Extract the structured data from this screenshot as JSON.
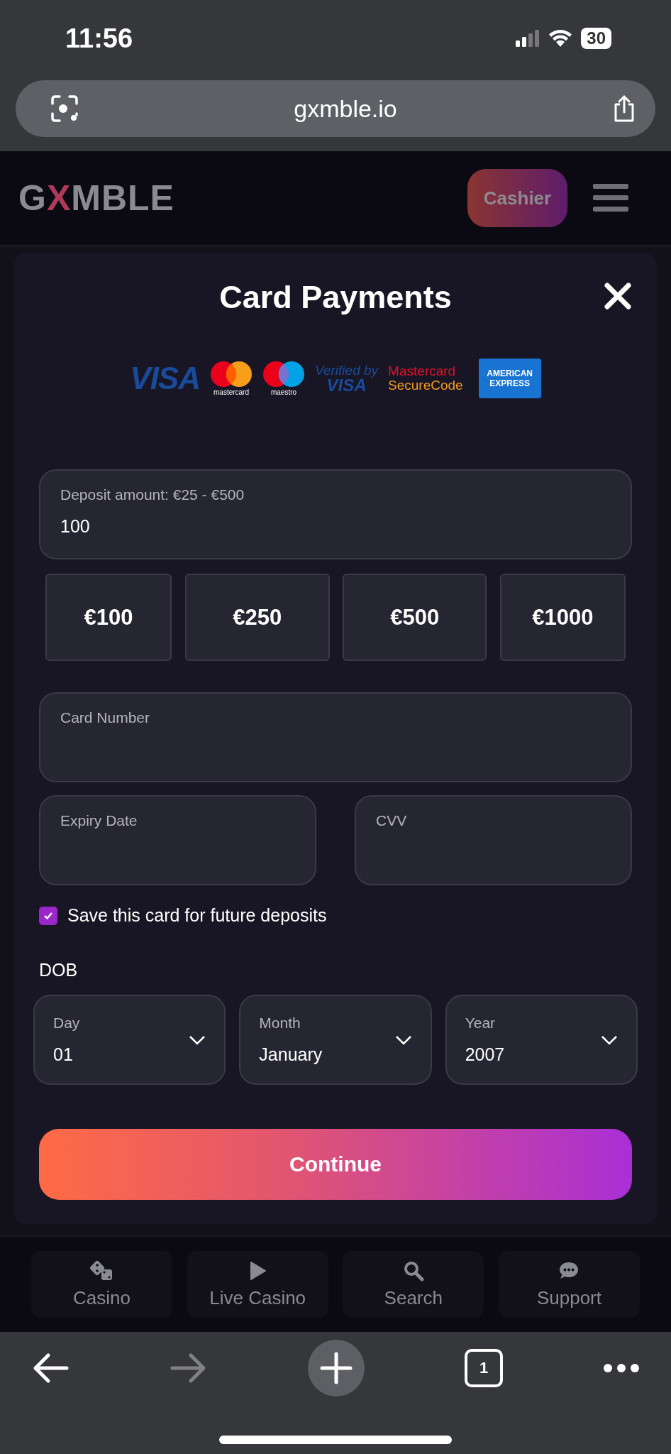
{
  "status_bar": {
    "time": "11:56",
    "battery": "30"
  },
  "browser": {
    "url": "gxmble.io",
    "tab_count": "1"
  },
  "header": {
    "logo": "GXMBLE",
    "cashier_button": "Cashier"
  },
  "modal": {
    "title": "Card Payments",
    "payment_logos": [
      {
        "kind": "visa",
        "lines": [
          "VISA"
        ]
      },
      {
        "kind": "mastercard",
        "lines": [
          "mastercard"
        ]
      },
      {
        "kind": "maestro",
        "lines": [
          "maestro"
        ]
      },
      {
        "kind": "verified",
        "lines": [
          "Verified by",
          "VISA"
        ]
      },
      {
        "kind": "securecode",
        "lines": [
          "Mastercard",
          "SecureCode"
        ]
      },
      {
        "kind": "amex",
        "lines": [
          "AMERICAN",
          "EXPRESS"
        ]
      }
    ],
    "deposit_field": {
      "label": "Deposit amount: €25 - €500",
      "value": "100"
    },
    "amount_buttons": [
      "€100",
      "€250",
      "€500",
      "€1000"
    ],
    "card_number": {
      "label": "Card Number"
    },
    "expiry": {
      "label": "Expiry Date"
    },
    "cvv": {
      "label": "CVV"
    },
    "save_card": {
      "label": "Save this card for future deposits",
      "checked": true
    },
    "dob": {
      "label": "DOB",
      "selects": [
        {
          "label": "Day",
          "value": "01"
        },
        {
          "label": "Month",
          "value": "January"
        },
        {
          "label": "Year",
          "value": "2007"
        }
      ]
    },
    "continue_button": "Continue"
  },
  "bottom_nav": [
    {
      "kind": "dice",
      "label": "Casino"
    },
    {
      "kind": "play",
      "label": "Live Casino"
    },
    {
      "kind": "search",
      "label": "Search"
    },
    {
      "kind": "chat",
      "label": "Support"
    }
  ]
}
